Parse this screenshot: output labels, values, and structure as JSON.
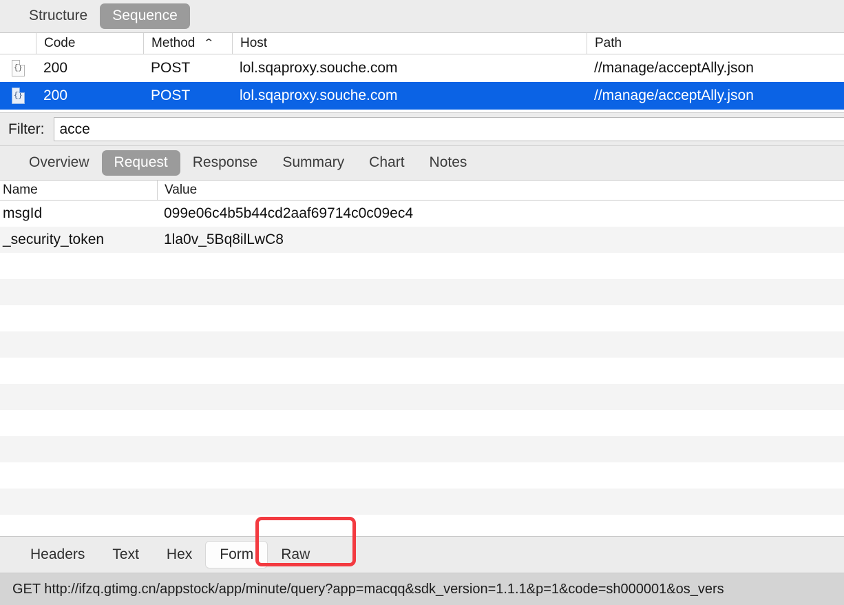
{
  "view_tabs": [
    {
      "label": "Structure",
      "selected": false
    },
    {
      "label": "Sequence",
      "selected": true
    }
  ],
  "sessions": {
    "columns": [
      {
        "key": "icon",
        "label": ""
      },
      {
        "key": "code",
        "label": "Code"
      },
      {
        "key": "method",
        "label": "Method",
        "sort": "⌃"
      },
      {
        "key": "host",
        "label": "Host"
      },
      {
        "key": "path",
        "label": "Path"
      }
    ],
    "rows": [
      {
        "icon": "{}",
        "code": "200",
        "method": "POST",
        "host": "lol.sqaproxy.souche.com",
        "path": "//manage/acceptAlly.json",
        "selected": false
      },
      {
        "icon": "{}",
        "code": "200",
        "method": "POST",
        "host": "lol.sqaproxy.souche.com",
        "path": "//manage/acceptAlly.json",
        "selected": true
      }
    ]
  },
  "filter": {
    "label": "Filter:",
    "value": "acce",
    "placeholder": ""
  },
  "detail_tabs": [
    {
      "label": "Overview",
      "selected": false
    },
    {
      "label": "Request",
      "selected": true
    },
    {
      "label": "Response",
      "selected": false
    },
    {
      "label": "Summary",
      "selected": false
    },
    {
      "label": "Chart",
      "selected": false
    },
    {
      "label": "Notes",
      "selected": false
    }
  ],
  "kvtable": {
    "headers": {
      "name": "Name",
      "value": "Value"
    },
    "rows": [
      {
        "name": "msgId",
        "value": "099e06c4b5b44cd2aaf69714c0c09ec4"
      },
      {
        "name": "_security_token",
        "value": "1la0v_5Bq8ilLwC8"
      },
      {
        "name": "",
        "value": ""
      },
      {
        "name": "",
        "value": ""
      },
      {
        "name": "",
        "value": ""
      },
      {
        "name": "",
        "value": ""
      },
      {
        "name": "",
        "value": ""
      },
      {
        "name": "",
        "value": ""
      },
      {
        "name": "",
        "value": ""
      },
      {
        "name": "",
        "value": ""
      },
      {
        "name": "",
        "value": ""
      },
      {
        "name": "",
        "value": ""
      }
    ]
  },
  "body_tabs": [
    {
      "label": "Headers",
      "selected": false
    },
    {
      "label": "Text",
      "selected": false
    },
    {
      "label": "Hex",
      "selected": false
    },
    {
      "label": "Form",
      "selected": true
    },
    {
      "label": "Raw",
      "selected": false
    }
  ],
  "annotation": {
    "target": "Form",
    "color": "#f33a40"
  },
  "statusbar": {
    "text": "GET http://ifzq.gtimg.cn/appstock/app/minute/query?app=macqq&sdk_version=1.1.1&p=1&code=sh000001&os_vers"
  }
}
